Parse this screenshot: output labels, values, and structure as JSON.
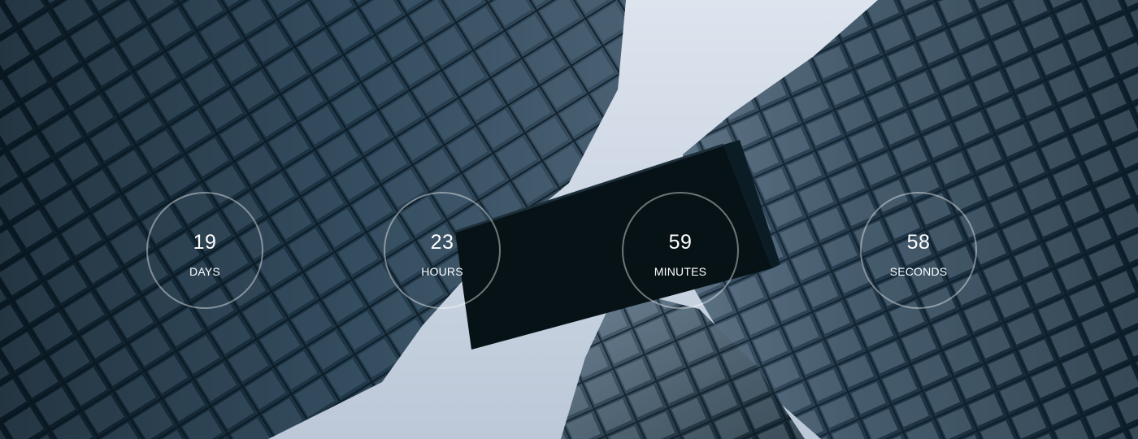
{
  "countdown": {
    "units": [
      {
        "value": "19",
        "label": "DAYS"
      },
      {
        "value": "23",
        "label": "HOURS"
      },
      {
        "value": "59",
        "label": "MINUTES"
      },
      {
        "value": "58",
        "label": "SECONDS"
      }
    ]
  },
  "colors": {
    "sky": "#c9d3e1",
    "building_dark": "#0d1f2b",
    "building_mid": "#233c4e",
    "bridge": "#061216",
    "ring": "rgba(255,255,255,0.42)",
    "text": "#ffffff"
  }
}
